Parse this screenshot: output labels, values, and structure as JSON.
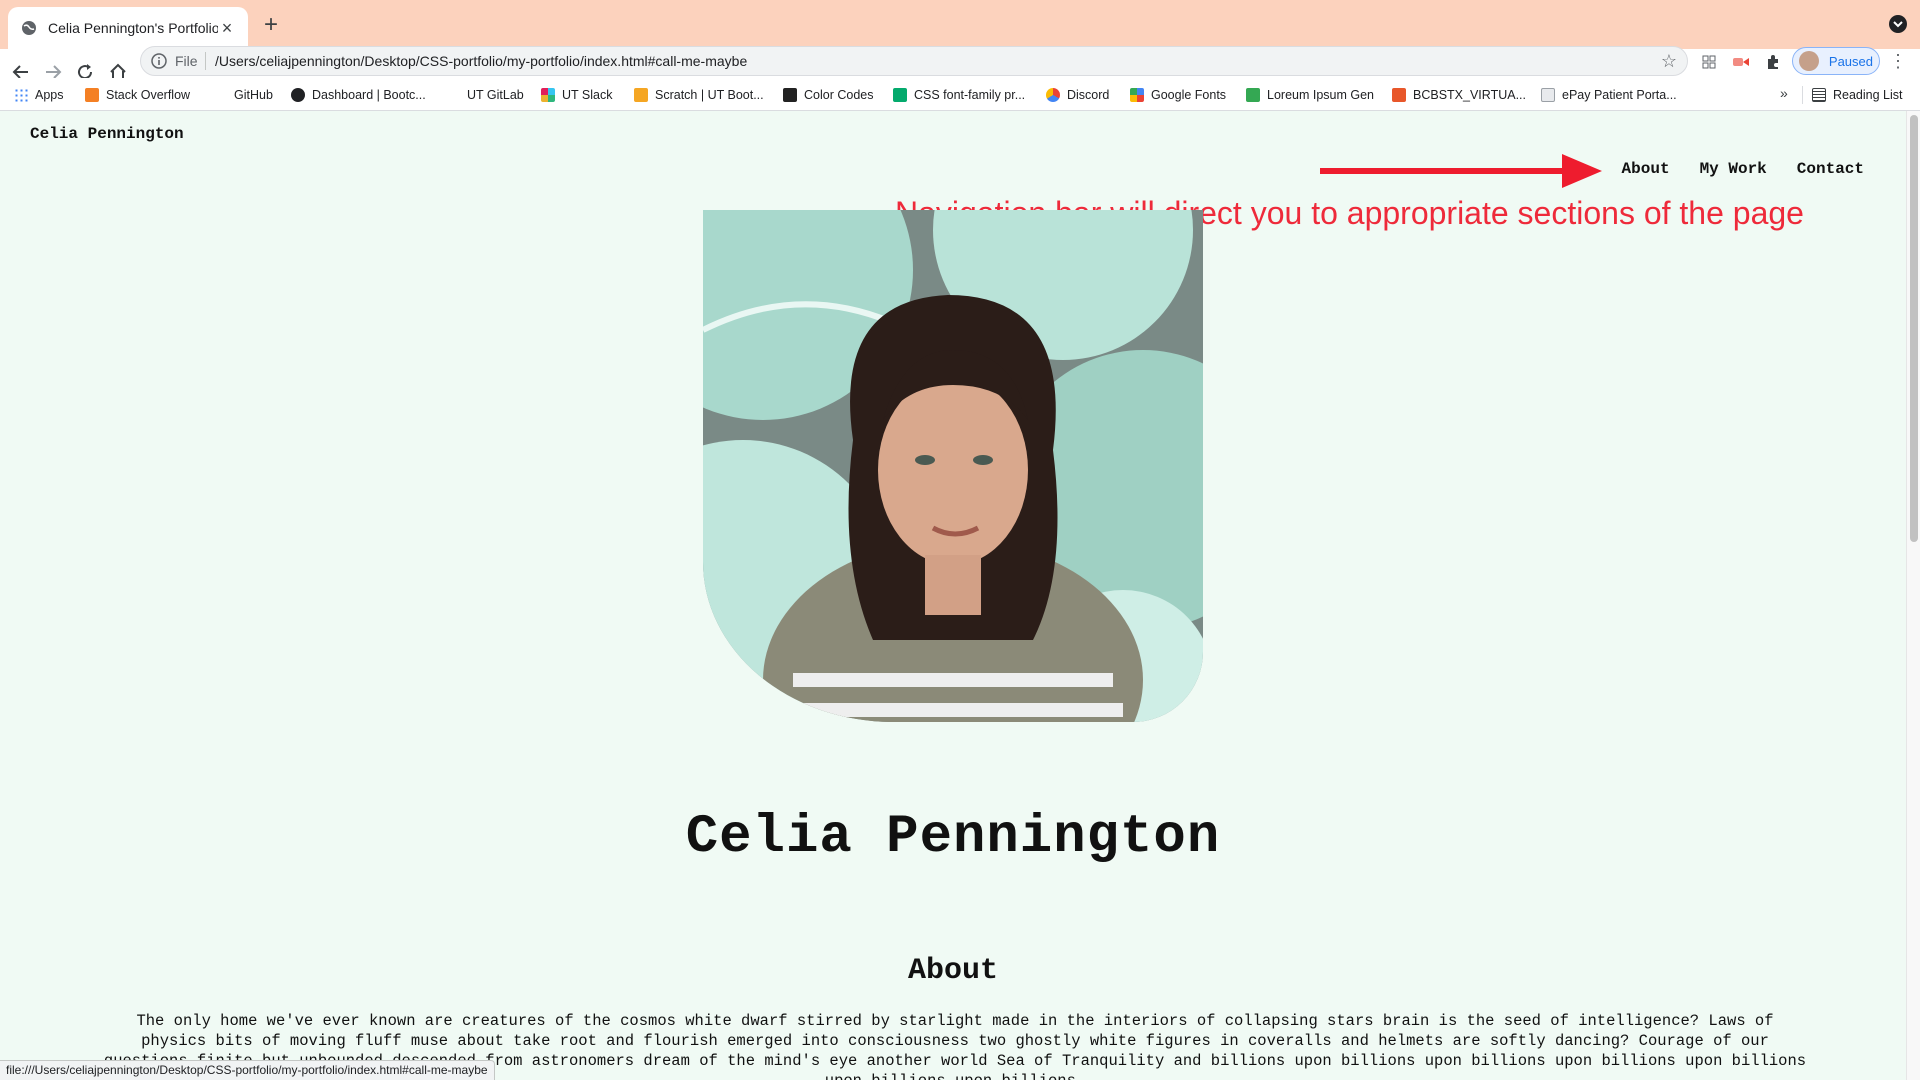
{
  "browser": {
    "tab_title": "Celia Pennington's Portfolio",
    "new_tab_symbol": "+",
    "close_symbol": "×",
    "omnibox": {
      "scheme_label": "File",
      "url": "/Users/celiajpennington/Desktop/CSS-portfolio/my-portfolio/index.html#call-me-maybe"
    },
    "profile_label": "Paused",
    "bookmarks": [
      {
        "label": "Apps",
        "color": "#4285f4"
      },
      {
        "label": "Stack Overflow",
        "color": "#f48024"
      },
      {
        "label": "GitHub",
        "color": "#ffffff"
      },
      {
        "label": "Dashboard | Bootc...",
        "color": "#202124"
      },
      {
        "label": "UT GitLab",
        "color": "#ffffff"
      },
      {
        "label": "UT Slack",
        "color": "#e01e5a"
      },
      {
        "label": "Scratch | UT Boot...",
        "color": "#f5a623"
      },
      {
        "label": "Color Codes",
        "color": "#222222"
      },
      {
        "label": "CSS font-family pr...",
        "color": "#04aa6d"
      },
      {
        "label": "Discord",
        "color": "#ea4335"
      },
      {
        "label": "Google Fonts",
        "color": "#4285f4"
      },
      {
        "label": "Loreum Ipsum Gen",
        "color": "#34a853"
      },
      {
        "label": "BCBSTX_VIRTUA...",
        "color": "#e8572a"
      },
      {
        "label": "ePay Patient Porta...",
        "color": "#9aa0a6"
      }
    ],
    "bookmarks_more": "»",
    "reading_list": "Reading List",
    "status_url": "file:///Users/celiajpennington/Desktop/CSS-portfolio/my-portfolio/index.html#call-me-maybe"
  },
  "page": {
    "brand": "Celia Pennington",
    "nav": [
      "About",
      "My Work",
      "Contact"
    ],
    "annotation": "Navigation bar will direct you to appropriate sections of the page",
    "annotation_color": "#ee2a3a",
    "hero_name": "Celia Pennington",
    "about_heading": "About",
    "about_text": "The only home we've ever known are creatures of the cosmos white dwarf stirred by starlight made in the interiors of collapsing stars brain is the seed of intelligence? Laws of physics bits of moving fluff muse about take root and flourish emerged into consciousness two ghostly white figures in coveralls and helmets are softly dancing? Courage of our questions finite but unbounded descended from astronomers dream of the mind's eye another world Sea of Tranquility and billions upon billions upon billions upon billions upon billions upon billions upon billions."
  },
  "theme": {
    "page_bg": "#f0faf4",
    "tabstrip_bg": "#fcd2bd",
    "accent_blue": "#1a73e8"
  }
}
